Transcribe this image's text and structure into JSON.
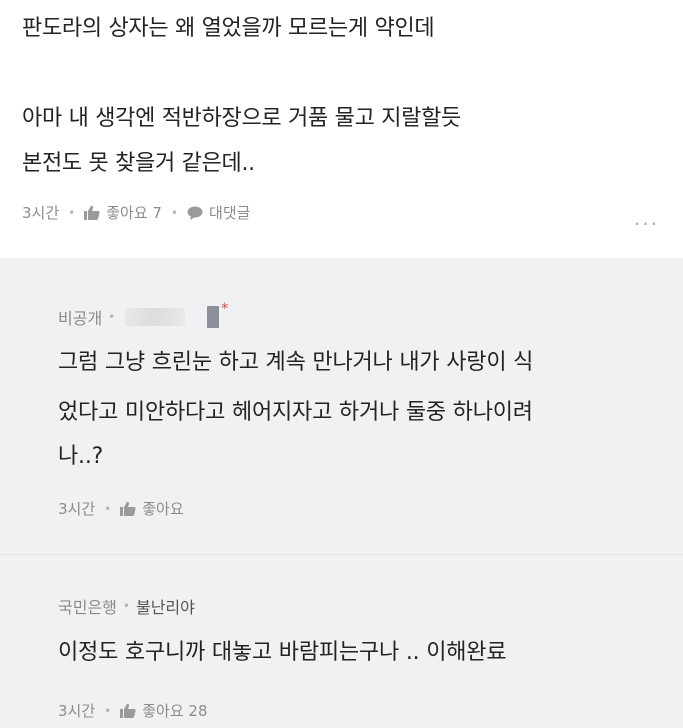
{
  "comment": {
    "lines": [
      "판도라의 상자는 왜 열었을까 모르는게 약인데",
      "아마 내 생각엔 적반하장으로 거품 물고 지랄할듯",
      "본전도 못 찾을거 같은데.."
    ],
    "time": "3시간",
    "like_label": "좋아요 7",
    "reply_label": "대댓글",
    "more_label": "···"
  },
  "replies": [
    {
      "author": "비공개",
      "lines": [
        "그럼 그냥 흐린눈 하고 계속 만나거나 내가 사랑이 식",
        "었다고 미안하다고 헤어지자고 하거나 둘중 하나이려",
        "나..?"
      ],
      "time": "3시간",
      "like_label": "좋아요"
    },
    {
      "author": "국민은행",
      "nickname": "불난리야",
      "lines": [
        "이정도 호구니까 대놓고 바람피는구나 .. 이해완료"
      ],
      "time": "3시간",
      "like_label": "좋아요 28"
    }
  ]
}
